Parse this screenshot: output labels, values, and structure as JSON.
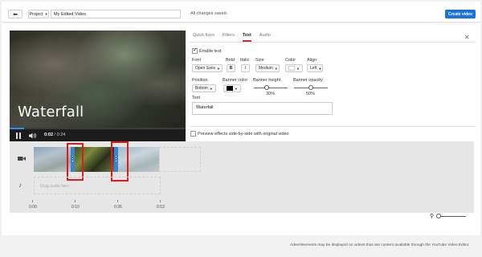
{
  "header": {
    "back_icon": "back-arrow-icon",
    "project_label": "Project",
    "title_value": "My Edited Video",
    "status": "All changes saved.",
    "create_label": "Create video",
    "accent": "#1a73d9"
  },
  "player": {
    "caption": "Waterfall",
    "current_time": "0:02",
    "time_separator": "/",
    "duration": "0:24",
    "progress_fraction": 0.08
  },
  "editor": {
    "tabs": [
      "Quick fixes",
      "Filters",
      "Text",
      "Audio"
    ],
    "active_tab": "Text",
    "enable_text_label": "Enable text",
    "enable_text_checked": true,
    "font_label": "Font",
    "font_value": "Open Sans",
    "bold_label": "Bold",
    "bold_glyph": "B",
    "italic_label": "Italic",
    "italic_glyph": "I",
    "size_label": "Size",
    "size_value": "Medium",
    "color_label": "Color",
    "color_value": "#ffffff",
    "align_label": "Align",
    "align_value": "Left",
    "position_label": "Position",
    "position_value": "Bottom",
    "banner_color_label": "Banner color",
    "banner_color_value": "#000000",
    "banner_height_label": "Banner height",
    "banner_height_value": "30%",
    "banner_height_fraction": 0.3,
    "banner_opacity_label": "Banner opacity",
    "banner_opacity_value": "50%",
    "banner_opacity_fraction": 0.5,
    "text_label": "Text",
    "text_value": "Waterfall",
    "preview_label": "Preview effects side-by-side with original video",
    "preview_checked": false
  },
  "timeline": {
    "audio_placeholder": "Drag audio here",
    "ticks": [
      "0:00",
      "0:10",
      "0:35",
      "0:53"
    ],
    "highlight_color": "#e01b1b",
    "handle_color": "#3b82d6"
  },
  "footer": {
    "note": "Advertisements may be displayed on videos that use content available through the YouTube Video Editor."
  }
}
